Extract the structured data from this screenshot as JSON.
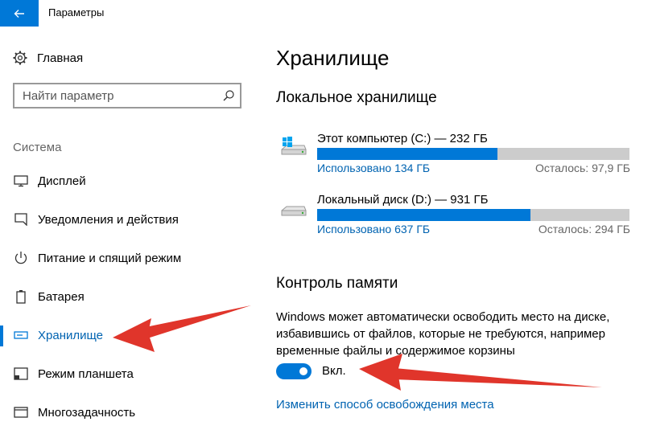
{
  "window": {
    "title": "Параметры",
    "back_icon": "back-arrow-icon"
  },
  "sidebar": {
    "home_label": "Главная",
    "search_placeholder": "Найти параметр",
    "section_title": "Система",
    "items": [
      {
        "label": "Дисплей",
        "icon": "display-icon"
      },
      {
        "label": "Уведомления и действия",
        "icon": "notifications-icon"
      },
      {
        "label": "Питание и спящий режим",
        "icon": "power-icon"
      },
      {
        "label": "Батарея",
        "icon": "battery-icon"
      },
      {
        "label": "Хранилище",
        "icon": "storage-icon",
        "active": true
      },
      {
        "label": "Режим планшета",
        "icon": "tablet-mode-icon"
      },
      {
        "label": "Многозадачность",
        "icon": "multitasking-icon"
      }
    ]
  },
  "main": {
    "title": "Хранилище",
    "local_storage_heading": "Локальное хранилище",
    "drives": [
      {
        "name": "Этот компьютер (C:) — 232 ГБ",
        "used": "Использовано 134 ГБ",
        "free": "Осталось: 97,9 ГБ",
        "used_fraction": 0.577
      },
      {
        "name": "Локальный диск (D:) — 931 ГБ",
        "used": "Использовано 637 ГБ",
        "free": "Осталось: 294 ГБ",
        "used_fraction": 0.684
      }
    ],
    "storage_sense_heading": "Контроль памяти",
    "storage_sense_description": "Windows может автоматически освободить место на диске, избавившись от файлов, которые не требуются, например временные файлы и содержимое корзины",
    "toggle_label": "Вкл.",
    "toggle_on": true,
    "change_link": "Изменить способ освобождения места"
  },
  "colors": {
    "accent": "#0078d7",
    "link": "#0063b1",
    "annotation_arrow": "#e0352b"
  }
}
